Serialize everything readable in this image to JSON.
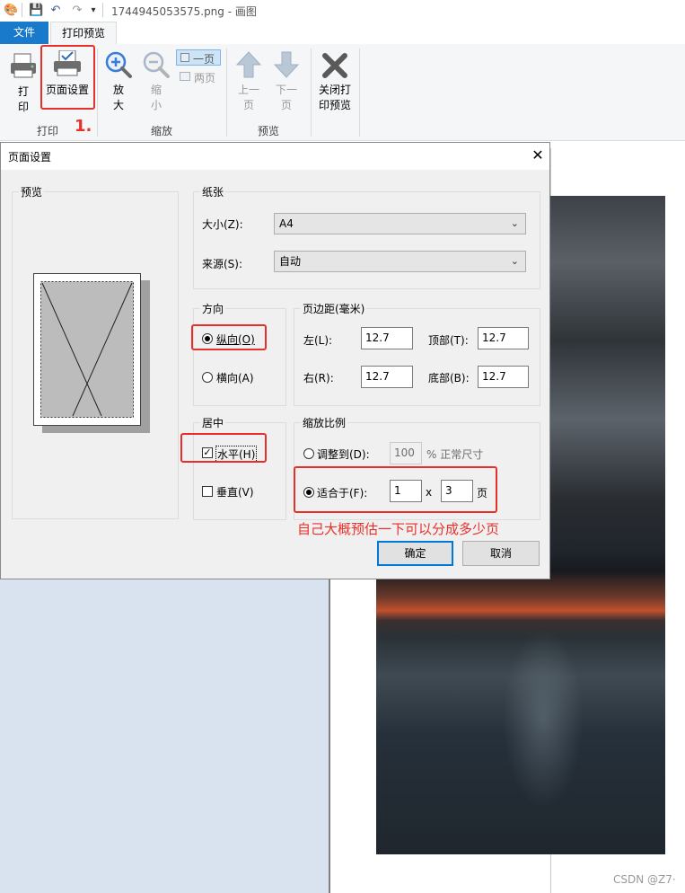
{
  "window": {
    "title": "1744945053575.png - 画图"
  },
  "tabs": [
    {
      "label": "文件"
    },
    {
      "label": "打印预览"
    }
  ],
  "ribbon": {
    "print_label_l1": "打",
    "print_label_l2": "印",
    "page_setup_label": "页面设置",
    "zoom_in_l1": "放",
    "zoom_in_l2": "大",
    "zoom_out_l1": "缩",
    "zoom_out_l2": "小",
    "one_page": "一页",
    "two_pages": "两页",
    "prev_l1": "上一",
    "prev_l2": "页",
    "next_l1": "下一",
    "next_l2": "页",
    "close_l1": "关闭打",
    "close_l2": "印预览",
    "groups": {
      "print": "打印",
      "zoom": "缩放",
      "preview": "预览"
    }
  },
  "annotations": {
    "step": "1.",
    "note": "自己大概预估一下可以分成多少页"
  },
  "dialog": {
    "title": "页面设置",
    "preview_label": "预览",
    "paper": {
      "label": "纸张",
      "size_label": "大小(Z):",
      "size_value": "A4",
      "source_label": "来源(S):",
      "source_value": "自动"
    },
    "orientation": {
      "label": "方向",
      "portrait": "纵向(O)",
      "landscape": "横向(A)",
      "selected": "portrait"
    },
    "margins": {
      "label": "页边距(毫米)",
      "left_label": "左(L):",
      "left": "12.7",
      "top_label": "顶部(T):",
      "top": "12.7",
      "right_label": "右(R):",
      "right": "12.7",
      "bottom_label": "底部(B):",
      "bottom": "12.7"
    },
    "centering": {
      "label": "居中",
      "horizontal": "水平(H)",
      "horizontal_checked": true,
      "vertical": "垂直(V)",
      "vertical_checked": false
    },
    "scaling": {
      "label": "缩放比例",
      "adjust_label": "调整到(D):",
      "adjust_value": "100",
      "adjust_suffix": "% 正常尺寸",
      "fit_label": "适合于(F):",
      "fit_x": "1",
      "fit_sep": "x",
      "fit_y": "3",
      "fit_suffix": "页",
      "selected": "fit"
    },
    "ok": "确定",
    "cancel": "取消"
  },
  "watermark": "CSDN @Z7·"
}
